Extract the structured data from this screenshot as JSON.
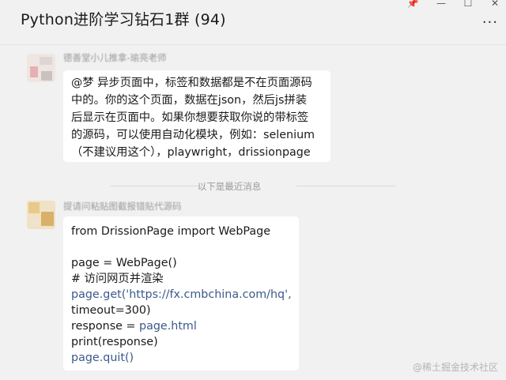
{
  "window": {
    "title": "Python进阶学习钻石1群 (94)",
    "controls": {
      "pin": "📌",
      "minimize": "—",
      "maximize": "☐",
      "close": "✕"
    },
    "more_label": "···"
  },
  "messages": [
    {
      "sender": "德善堂小儿推拿-瑜亮老师",
      "lines": [
        "@梦 异步页面中，标签和数据都是不在页面源码",
        "中的。你的这个页面，数据在json，然后js拼装",
        "后显示在页面中。如果你想要获取你说的带标签",
        "的源码，可以使用自动化模块，例如：selenium",
        "（不建议用这个），playwright，drissionpage"
      ]
    },
    {
      "sender": "提请问粘贴图截报错贴代源码",
      "code_lines": [
        "from DrissionPage import WebPage",
        "",
        "page = WebPage()",
        "# 访问网页并渲染",
        "page.get('https://fx.cmbchina.com/hq',",
        "timeout=300)",
        "response = page.html",
        "print(response)",
        "page.quit()"
      ]
    }
  ],
  "divider_text": "以下是最近消息",
  "watermark": "@稀土掘金技术社区",
  "colors": {
    "background": "#f1f1f1",
    "bubble": "#ffffff",
    "code_highlight": "#3b5a8a"
  }
}
